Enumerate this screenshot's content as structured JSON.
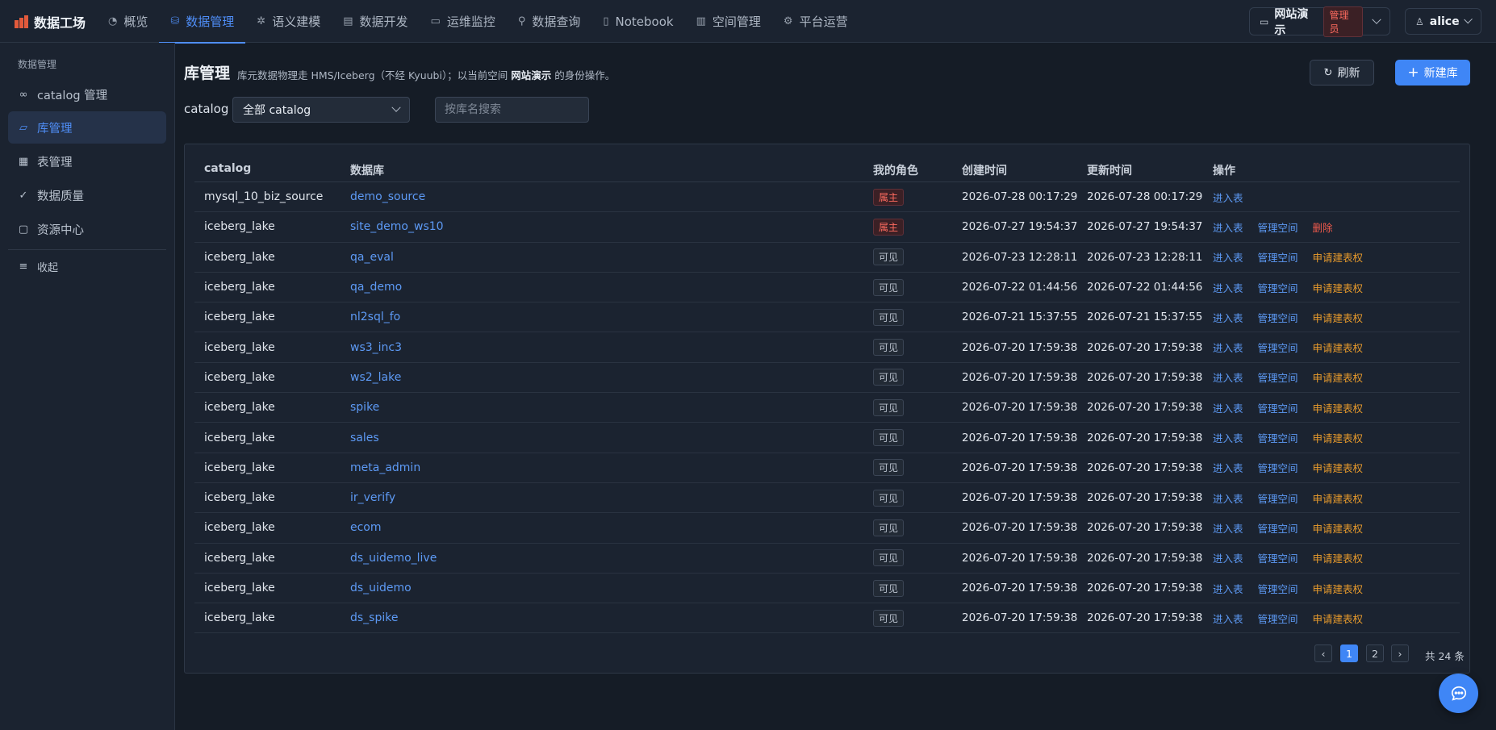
{
  "app": {
    "name": "数据工场"
  },
  "nav": [
    {
      "label": "概览",
      "icon": "gauge-icon"
    },
    {
      "label": "数据管理",
      "icon": "database-icon",
      "active": true
    },
    {
      "label": "语义建模",
      "icon": "sparkle-icon"
    },
    {
      "label": "数据开发",
      "icon": "code-file-icon"
    },
    {
      "label": "运维监控",
      "icon": "monitor-icon"
    },
    {
      "label": "数据查询",
      "icon": "search-icon"
    },
    {
      "label": "Notebook",
      "icon": "notebook-icon"
    },
    {
      "label": "空间管理",
      "icon": "building-icon"
    },
    {
      "label": "平台运营",
      "icon": "gear-icon"
    }
  ],
  "workspace": {
    "name": "网站演示",
    "role": "管理员"
  },
  "user": {
    "name": "alice"
  },
  "sidebar": {
    "group": "数据管理",
    "items": [
      {
        "label": "catalog 管理",
        "icon": "link-icon"
      },
      {
        "label": "库管理",
        "icon": "folder-icon",
        "active": true
      },
      {
        "label": "表管理",
        "icon": "table-icon"
      },
      {
        "label": "数据质量",
        "icon": "check-circle-icon"
      },
      {
        "label": "资源中心",
        "icon": "briefcase-icon"
      }
    ],
    "collapse": "收起"
  },
  "page": {
    "title": "库管理",
    "desc_prefix": "库元数据物理走 HMS/Iceberg（不经 Kyuubi）；以当前空间",
    "desc_ws": "网站演示",
    "desc_suffix": "的身份操作。",
    "refresh": "刷新",
    "new_db": "新建库"
  },
  "filters": {
    "catalog_label": "catalog",
    "catalog_value": "全部 catalog",
    "search_placeholder": "按库名搜索"
  },
  "table": {
    "headers": [
      "catalog",
      "数据库",
      "我的角色",
      "创建时间",
      "更新时间",
      "操作"
    ],
    "rows": [
      {
        "catalog": "mysql_10_biz_source",
        "db": "demo_source",
        "role": "属主",
        "role_kind": "owner",
        "created": "2026-07-28 00:17:29",
        "updated": "2026-07-28 00:17:29",
        "ops": [
          "进入表"
        ]
      },
      {
        "catalog": "iceberg_lake",
        "db": "site_demo_ws10",
        "role": "属主",
        "role_kind": "owner",
        "created": "2026-07-27 19:54:37",
        "updated": "2026-07-27 19:54:37",
        "ops": [
          "进入表",
          "管理空间",
          "删除"
        ]
      },
      {
        "catalog": "iceberg_lake",
        "db": "qa_eval",
        "role": "可见",
        "role_kind": "visible",
        "created": "2026-07-23 12:28:11",
        "updated": "2026-07-23 12:28:11",
        "ops": [
          "进入表",
          "管理空间",
          "申请建表权"
        ]
      },
      {
        "catalog": "iceberg_lake",
        "db": "qa_demo",
        "role": "可见",
        "role_kind": "visible",
        "created": "2026-07-22 01:44:56",
        "updated": "2026-07-22 01:44:56",
        "ops": [
          "进入表",
          "管理空间",
          "申请建表权"
        ]
      },
      {
        "catalog": "iceberg_lake",
        "db": "nl2sql_fo",
        "role": "可见",
        "role_kind": "visible",
        "created": "2026-07-21 15:37:55",
        "updated": "2026-07-21 15:37:55",
        "ops": [
          "进入表",
          "管理空间",
          "申请建表权"
        ]
      },
      {
        "catalog": "iceberg_lake",
        "db": "ws3_inc3",
        "role": "可见",
        "role_kind": "visible",
        "created": "2026-07-20 17:59:38",
        "updated": "2026-07-20 17:59:38",
        "ops": [
          "进入表",
          "管理空间",
          "申请建表权"
        ]
      },
      {
        "catalog": "iceberg_lake",
        "db": "ws2_lake",
        "role": "可见",
        "role_kind": "visible",
        "created": "2026-07-20 17:59:38",
        "updated": "2026-07-20 17:59:38",
        "ops": [
          "进入表",
          "管理空间",
          "申请建表权"
        ]
      },
      {
        "catalog": "iceberg_lake",
        "db": "spike",
        "role": "可见",
        "role_kind": "visible",
        "created": "2026-07-20 17:59:38",
        "updated": "2026-07-20 17:59:38",
        "ops": [
          "进入表",
          "管理空间",
          "申请建表权"
        ]
      },
      {
        "catalog": "iceberg_lake",
        "db": "sales",
        "role": "可见",
        "role_kind": "visible",
        "created": "2026-07-20 17:59:38",
        "updated": "2026-07-20 17:59:38",
        "ops": [
          "进入表",
          "管理空间",
          "申请建表权"
        ]
      },
      {
        "catalog": "iceberg_lake",
        "db": "meta_admin",
        "role": "可见",
        "role_kind": "visible",
        "created": "2026-07-20 17:59:38",
        "updated": "2026-07-20 17:59:38",
        "ops": [
          "进入表",
          "管理空间",
          "申请建表权"
        ]
      },
      {
        "catalog": "iceberg_lake",
        "db": "ir_verify",
        "role": "可见",
        "role_kind": "visible",
        "created": "2026-07-20 17:59:38",
        "updated": "2026-07-20 17:59:38",
        "ops": [
          "进入表",
          "管理空间",
          "申请建表权"
        ]
      },
      {
        "catalog": "iceberg_lake",
        "db": "ecom",
        "role": "可见",
        "role_kind": "visible",
        "created": "2026-07-20 17:59:38",
        "updated": "2026-07-20 17:59:38",
        "ops": [
          "进入表",
          "管理空间",
          "申请建表权"
        ]
      },
      {
        "catalog": "iceberg_lake",
        "db": "ds_uidemo_live",
        "role": "可见",
        "role_kind": "visible",
        "created": "2026-07-20 17:59:38",
        "updated": "2026-07-20 17:59:38",
        "ops": [
          "进入表",
          "管理空间",
          "申请建表权"
        ]
      },
      {
        "catalog": "iceberg_lake",
        "db": "ds_uidemo",
        "role": "可见",
        "role_kind": "visible",
        "created": "2026-07-20 17:59:38",
        "updated": "2026-07-20 17:59:38",
        "ops": [
          "进入表",
          "管理空间",
          "申请建表权"
        ]
      },
      {
        "catalog": "iceberg_lake",
        "db": "ds_spike",
        "role": "可见",
        "role_kind": "visible",
        "created": "2026-07-20 17:59:38",
        "updated": "2026-07-20 17:59:38",
        "ops": [
          "进入表",
          "管理空间",
          "申请建表权"
        ]
      }
    ]
  },
  "pagination": {
    "pages": [
      "1",
      "2"
    ],
    "current": "1",
    "total": "共 24 条"
  },
  "colors": {
    "accent": "#3f86f6",
    "link": "#5d9af5",
    "danger": "#ef5a4c",
    "warn": "#e89b2c",
    "bg": "#151c26",
    "panel": "#1b2330"
  }
}
